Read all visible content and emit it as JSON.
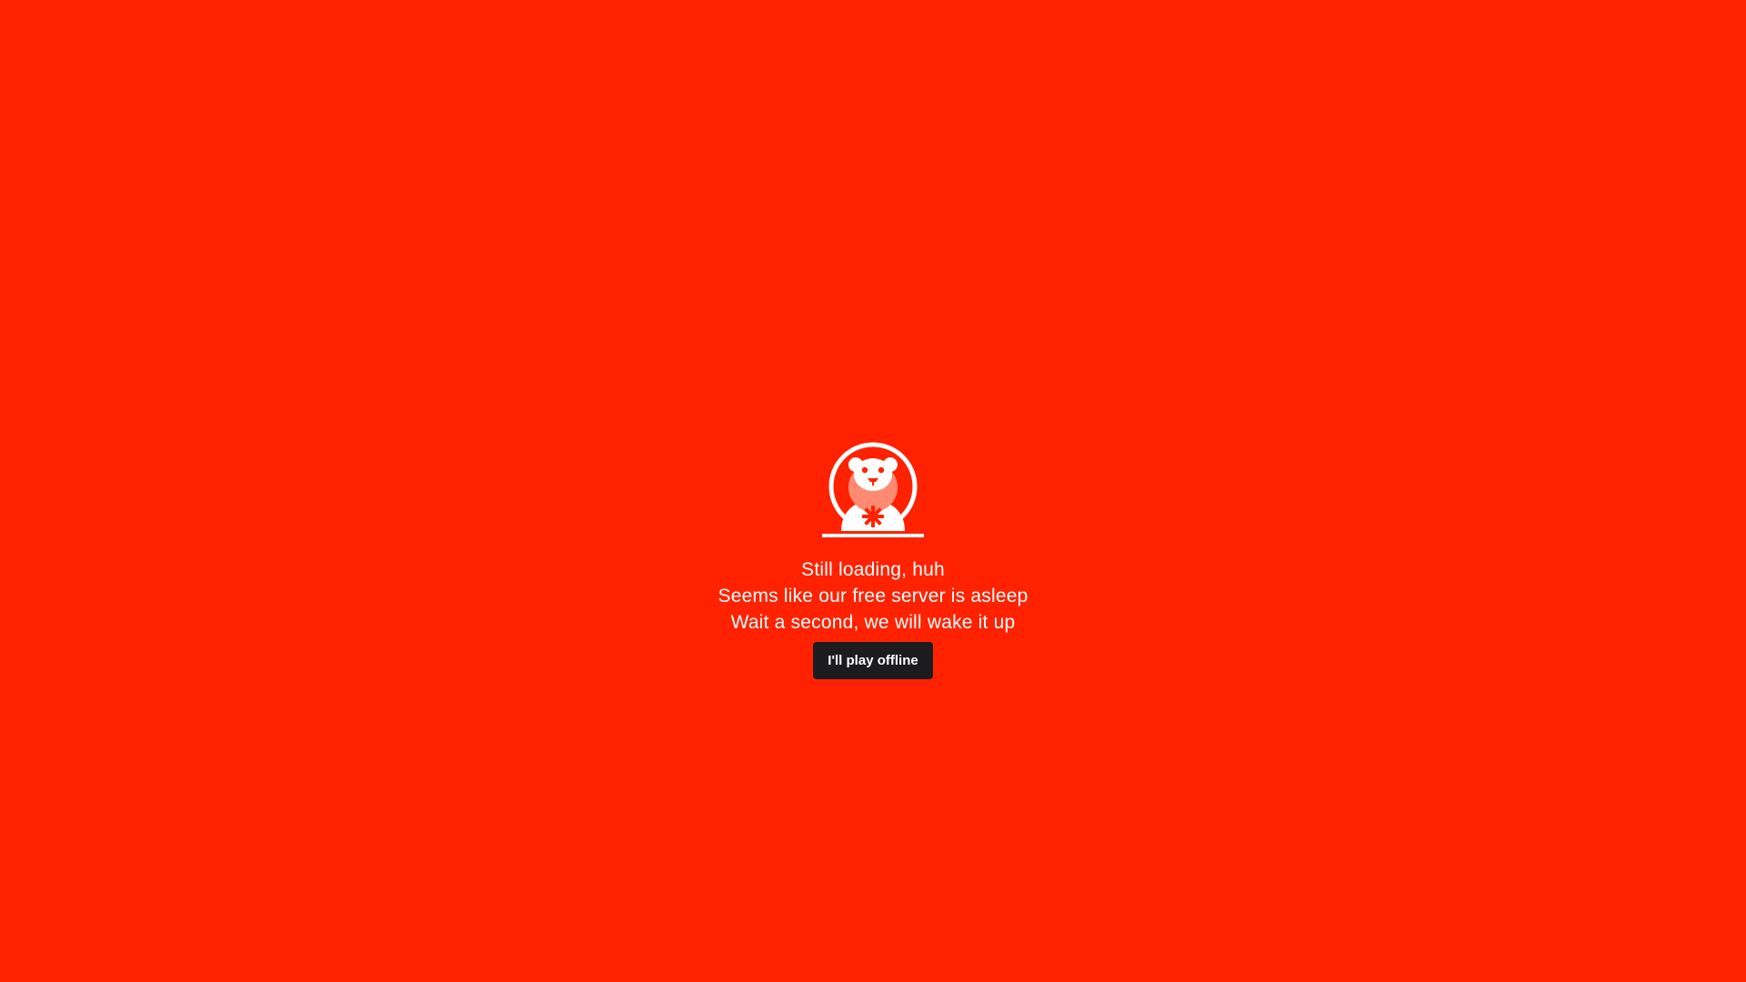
{
  "logo": {
    "icon": "bear-logo-icon",
    "colors": {
      "background": "#FF2200",
      "primary": "#FFFFFF",
      "face_circle": "#FF8A72"
    }
  },
  "messages": {
    "line1": "Still loading, huh",
    "line2": "Seems like our free server is asleep",
    "line3": "Wait a second, we will wake it up"
  },
  "button": {
    "label": "I'll play offline",
    "background": "#1C1C1E"
  }
}
